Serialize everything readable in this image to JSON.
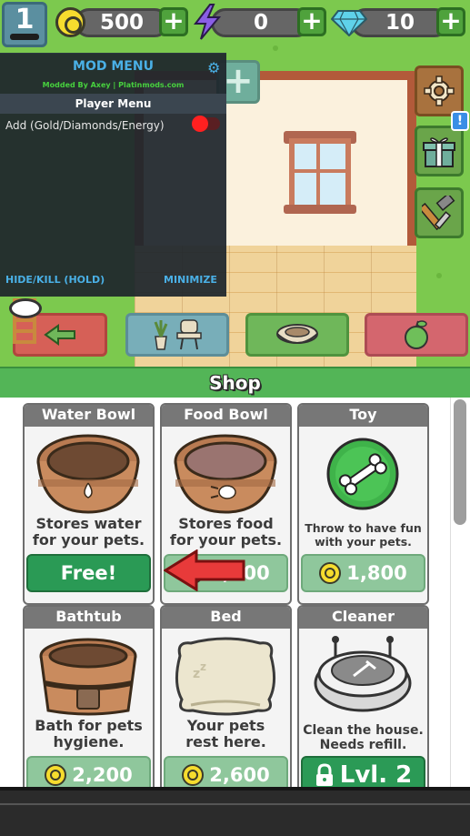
{
  "hud": {
    "level": "1",
    "gold": "500",
    "energy": "0",
    "diamonds": "10",
    "plus_label": "+"
  },
  "mod_menu": {
    "title": "MOD MENU",
    "credit": "Modded By Axey | Platinmods.com",
    "section": "Player Menu",
    "option_add": "Add (Gold/Diamonds/Energy)",
    "option_add_enabled": false,
    "hide_kill": "HIDE/KILL (HOLD)",
    "minimize": "MINIMIZE"
  },
  "scene": {
    "plus_tile_label": "+",
    "alert_label": "!"
  },
  "shop": {
    "title": "Shop",
    "items": [
      {
        "name": "Water Bowl",
        "desc_line1": "Stores water",
        "desc_line2": "for your pets.",
        "price": "Free!",
        "icon": "water-bowl-icon"
      },
      {
        "name": "Food Bowl",
        "desc_line1": "Stores food",
        "desc_line2": "for your pets.",
        "price": "1,500",
        "icon": "food-bowl-icon"
      },
      {
        "name": "Toy",
        "desc_line1": "Throw to have fun",
        "desc_line2": "with your pets.",
        "price": "1,800",
        "icon": "toy-ball-icon"
      },
      {
        "name": "Bathtub",
        "desc_line1": "Bath for pets",
        "desc_line2": "hygiene.",
        "price": "2,200",
        "icon": "bathtub-icon"
      },
      {
        "name": "Bed",
        "desc_line1": "Your pets",
        "desc_line2": "rest here.",
        "price": "2,600",
        "icon": "pet-bed-icon"
      },
      {
        "name": "Cleaner",
        "desc_line1": "Clean the house.",
        "desc_line2": "Needs refill.",
        "price": "Lvl. 2",
        "icon": "robot-cleaner-icon"
      }
    ]
  },
  "colors": {
    "shop_green": "#53b557",
    "free_button": "#2a9a55",
    "price_button": "#8fc79c",
    "mod_accent": "#4ab0e6"
  }
}
